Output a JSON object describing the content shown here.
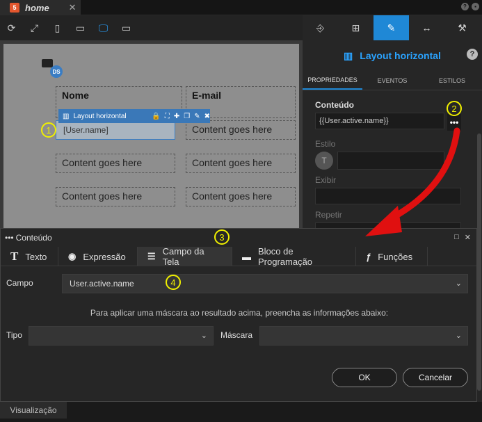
{
  "tab": {
    "badge": "5",
    "title": "home",
    "close": "✕"
  },
  "top_right": {
    "help": "?",
    "user": "▪"
  },
  "toolbar": {
    "icons": [
      "refresh-icon",
      "expand-icon",
      "phone-icon",
      "tablet-icon",
      "desktop-icon",
      "monitor-icon"
    ]
  },
  "canvas": {
    "ds_badge": "DS",
    "headers": [
      "Nome",
      "E-mail"
    ],
    "selected_cell": "[User.name]",
    "placeholder": "Content goes here",
    "selection_bar_label": "Layout horizontal",
    "selection_bar_icons": [
      "🔒",
      "⛶",
      "✚",
      "❐",
      "✎",
      "✖"
    ]
  },
  "right_panel": {
    "title": "Layout horizontal",
    "help": "?",
    "subtabs": [
      "PROPRIEDADES",
      "EVENTOS",
      "ESTILOS"
    ],
    "conteudo_label": "Conteúdo",
    "conteudo_value": "{{User.active.name}}",
    "estilo_label": "Estilo",
    "estilo_avatar": "T",
    "exibir_label": "Exibir",
    "repetir_label": "Repetir",
    "dots": "•••"
  },
  "dialog": {
    "title": "Conteúdo",
    "title_prefix": "•••",
    "tabs": [
      {
        "icon": "T",
        "label": "Texto"
      },
      {
        "icon": "👁",
        "label": "Expressão"
      },
      {
        "icon": "☰",
        "label": "Campo da Tela"
      },
      {
        "icon": "▬",
        "label": "Bloco de Programação"
      },
      {
        "icon": "ƒ",
        "label": "Funções"
      }
    ],
    "campo_label": "Campo",
    "campo_value": "User.active.name",
    "hint": "Para aplicar uma máscara ao resultado acima, preencha as informações abaixo:",
    "tipo_label": "Tipo",
    "mascara_label": "Máscara",
    "ok": "OK",
    "cancel": "Cancelar"
  },
  "footer": {
    "tab": "Visualização"
  },
  "annotations": [
    "1",
    "2",
    "3",
    "4"
  ],
  "colors": {
    "accent": "#1f88d6",
    "callout": "#f0f000",
    "arrow": "#e01010"
  }
}
